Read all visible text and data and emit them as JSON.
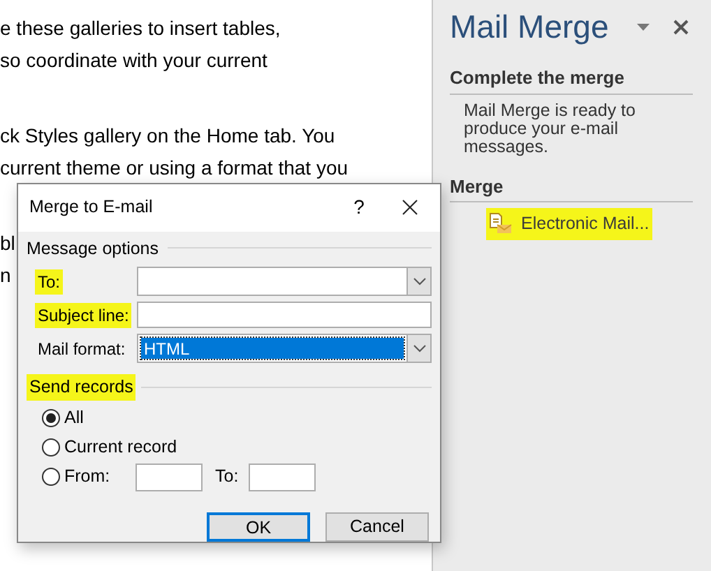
{
  "document": {
    "paragraphs": [
      [
        "e these galleries to insert tables,",
        "so coordinate with your current"
      ],
      [
        "ck Styles gallery on the Home tab. You",
        "current theme or using a format that you"
      ],
      [
        "bl",
        "n"
      ]
    ]
  },
  "task_pane": {
    "title": "Mail Merge",
    "sections": [
      {
        "heading": "Complete the merge",
        "text": "Mail Merge is ready to produce your e-mail messages."
      },
      {
        "heading": "Merge",
        "link": {
          "label": "Electronic Mail...",
          "highlighted": true
        }
      }
    ]
  },
  "dialog": {
    "title": "Merge to E-mail",
    "help": "?",
    "message_options": {
      "heading": "Message options",
      "fields": [
        {
          "kind": "combo",
          "label": "To:",
          "highlighted": true
        },
        {
          "kind": "text",
          "label": "Subject line:",
          "highlighted": true
        },
        {
          "kind": "combo",
          "label": "Mail format:",
          "highlighted": false,
          "value": "HTML",
          "selected": true
        }
      ]
    },
    "send_records": {
      "heading": "Send records",
      "highlighted": true,
      "options": [
        {
          "label": "All",
          "selected": true
        },
        {
          "label": "Current record",
          "selected": false
        },
        {
          "label": "From:",
          "selected": false,
          "to_label": "To:"
        }
      ]
    },
    "buttons": [
      {
        "label": "OK",
        "default": true
      },
      {
        "label": "Cancel",
        "default": false
      }
    ]
  }
}
